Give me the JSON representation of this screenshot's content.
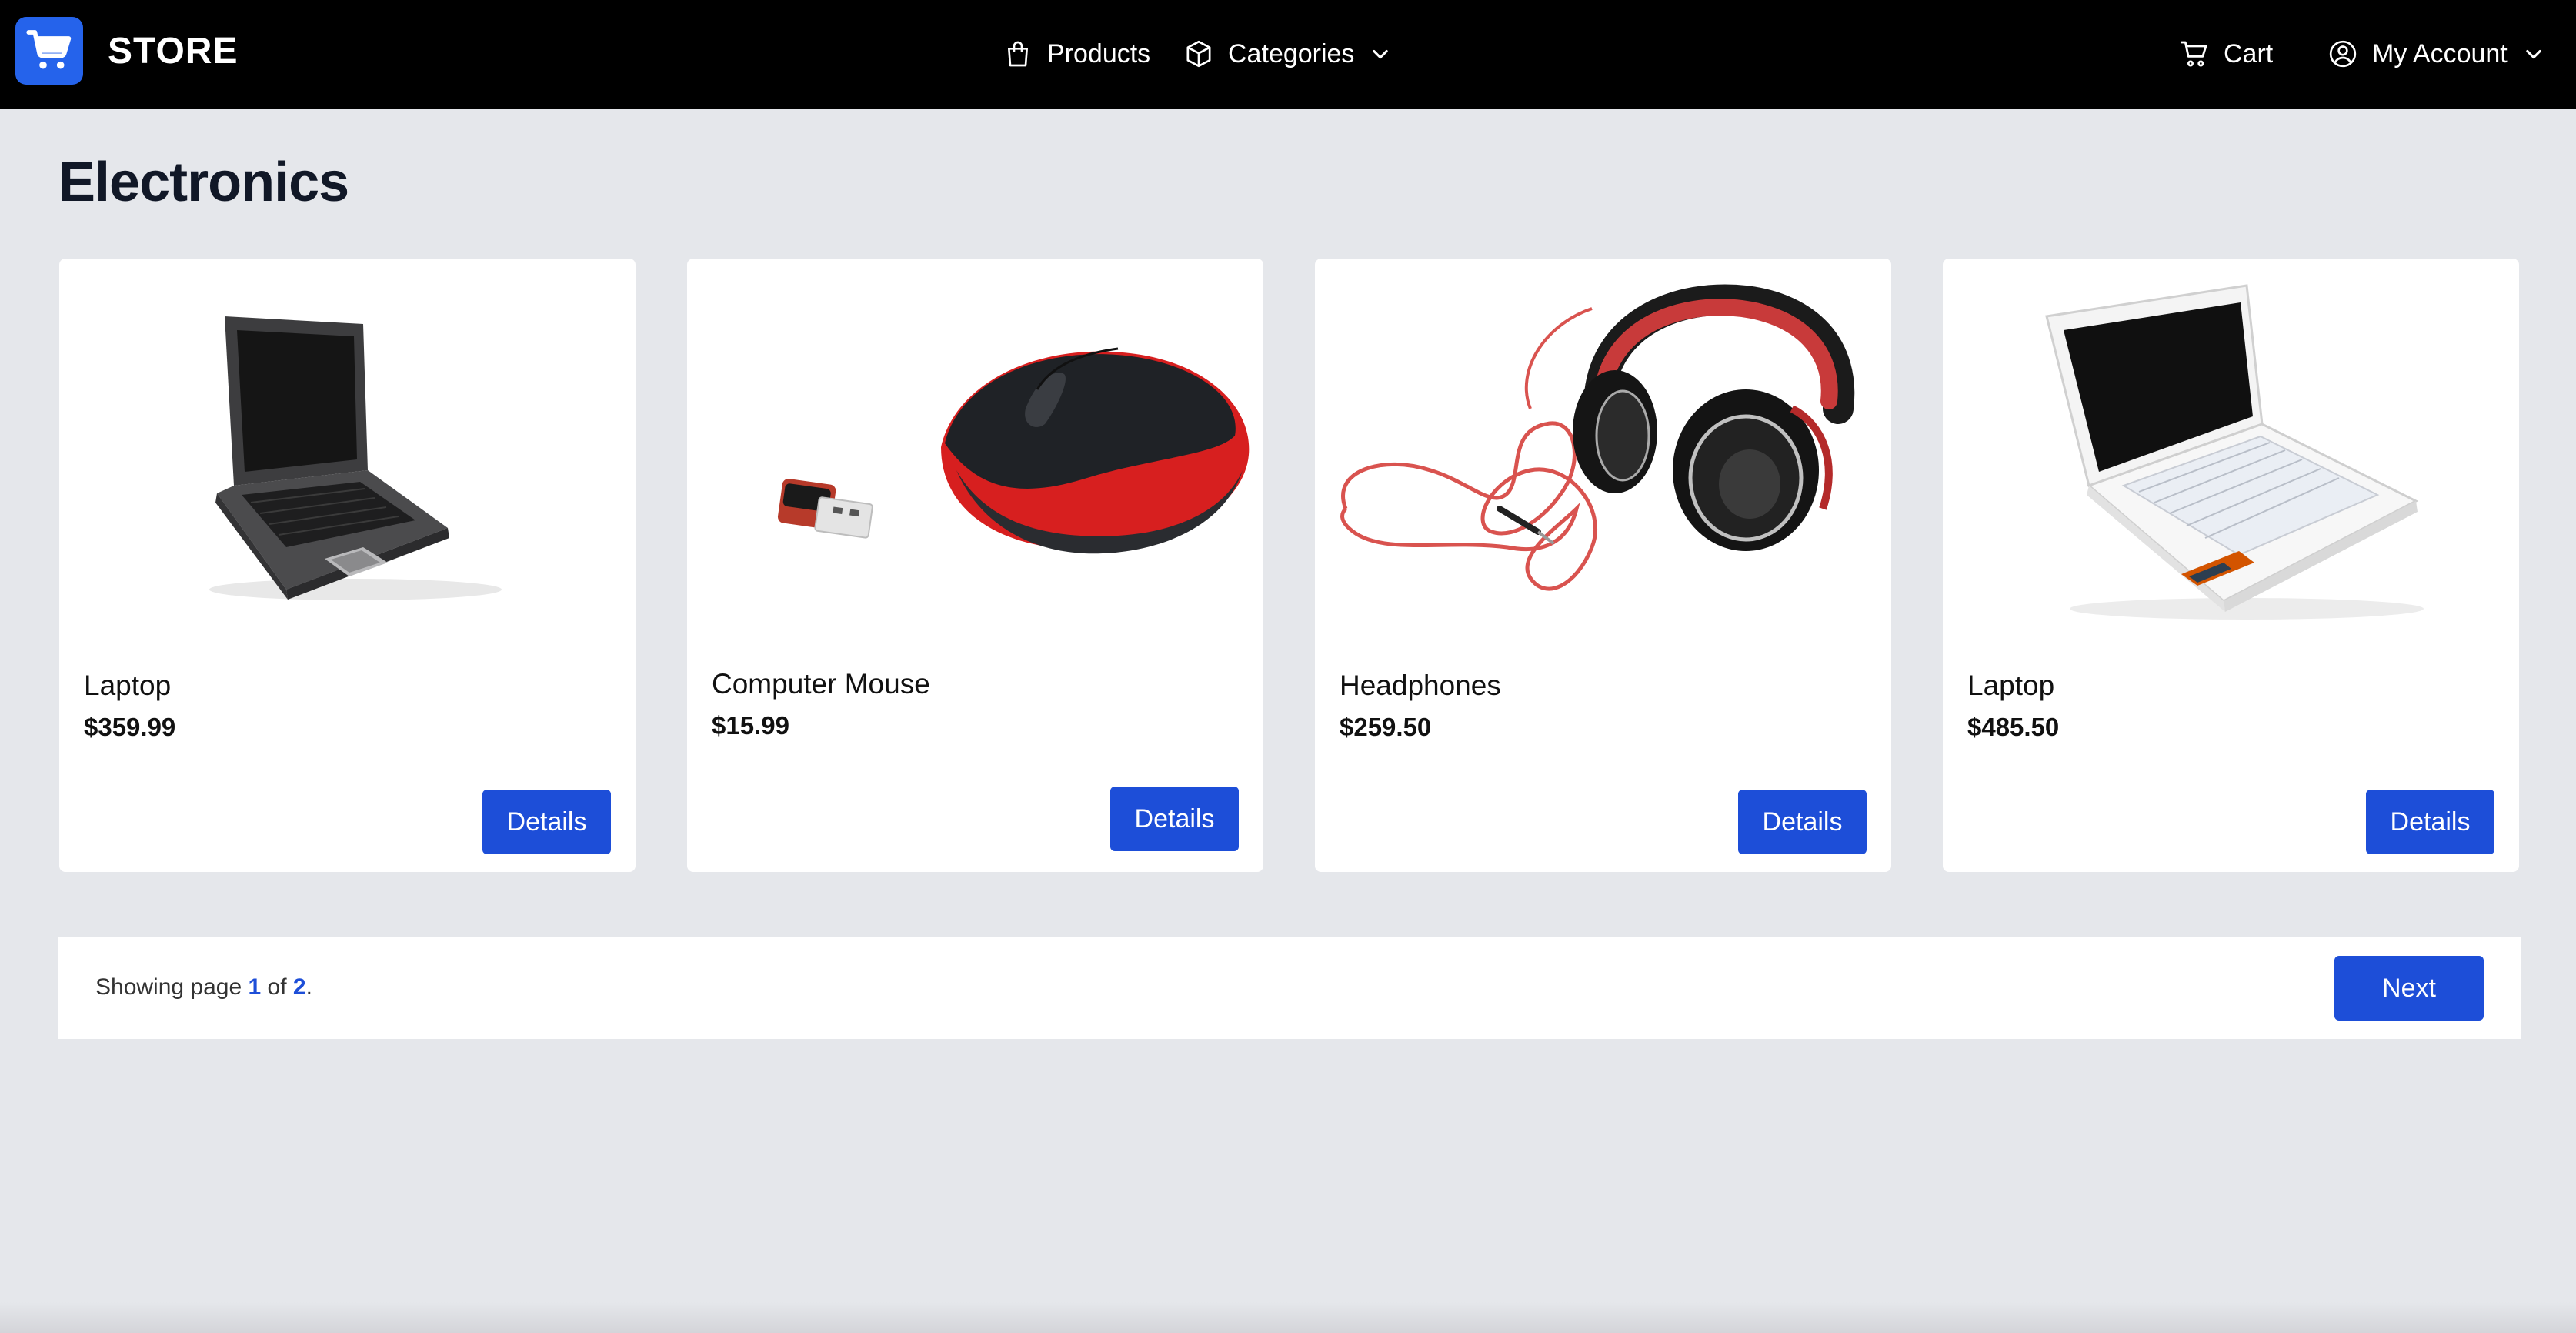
{
  "header": {
    "brand": "STORE",
    "nav": {
      "products": "Products",
      "categories": "Categories",
      "cart": "Cart",
      "account": "My Account"
    }
  },
  "page": {
    "title": "Electronics"
  },
  "products": [
    {
      "name": "Laptop",
      "price": "$359.99",
      "button": "Details",
      "image": "dark-laptop-image"
    },
    {
      "name": "Computer Mouse",
      "price": "$15.99",
      "button": "Details",
      "image": "wireless-mouse-image"
    },
    {
      "name": "Headphones",
      "price": "$259.50",
      "button": "Details",
      "image": "headphones-image"
    },
    {
      "name": "Laptop",
      "price": "$485.50",
      "button": "Details",
      "image": "white-netbook-image"
    }
  ],
  "pagination": {
    "prefix": "Showing page ",
    "current": "1",
    "of": " of ",
    "total": "2",
    "suffix": ".",
    "next": "Next"
  },
  "colors": {
    "accent": "#1d4ed8",
    "logo_bg": "#2563eb",
    "header_bg": "#000000",
    "page_bg": "#e5e7eb"
  },
  "icons": [
    "cart-logo-icon",
    "shopping-bag-icon",
    "box-icon",
    "chevron-down-icon",
    "cart-icon",
    "user-circle-icon"
  ]
}
